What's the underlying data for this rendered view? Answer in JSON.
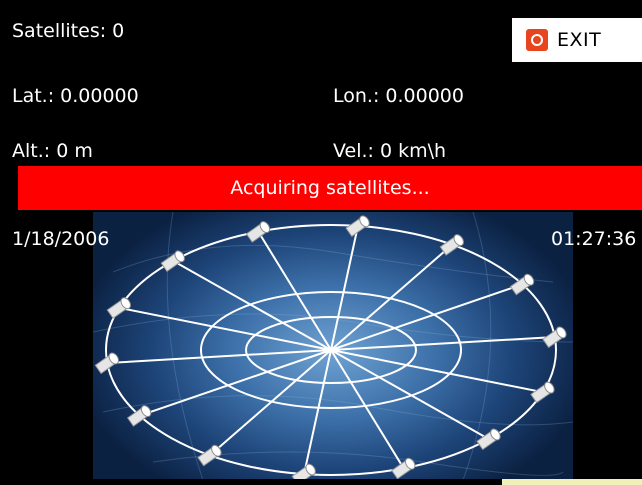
{
  "gps": {
    "satellites": "Satellites: 0",
    "latitude": "Lat.: 0.00000",
    "longitude": "Lon.: 0.00000",
    "altitude": "Alt.: 0 m",
    "velocity": "Vel.: 0 km\\h",
    "status": "Acquiring satellites...",
    "date": "1/18/2006",
    "time": "01:27:36"
  },
  "exit_button": {
    "label": "EXIT",
    "icon": "power-icon"
  },
  "colors": {
    "background": "#000000",
    "status_bar": "#ff0000",
    "text": "#ffffff",
    "exit_icon": "#e8451f"
  },
  "sky_view": {
    "satellite_icon": "satellite-icon",
    "satellite_count_shown": 14
  }
}
